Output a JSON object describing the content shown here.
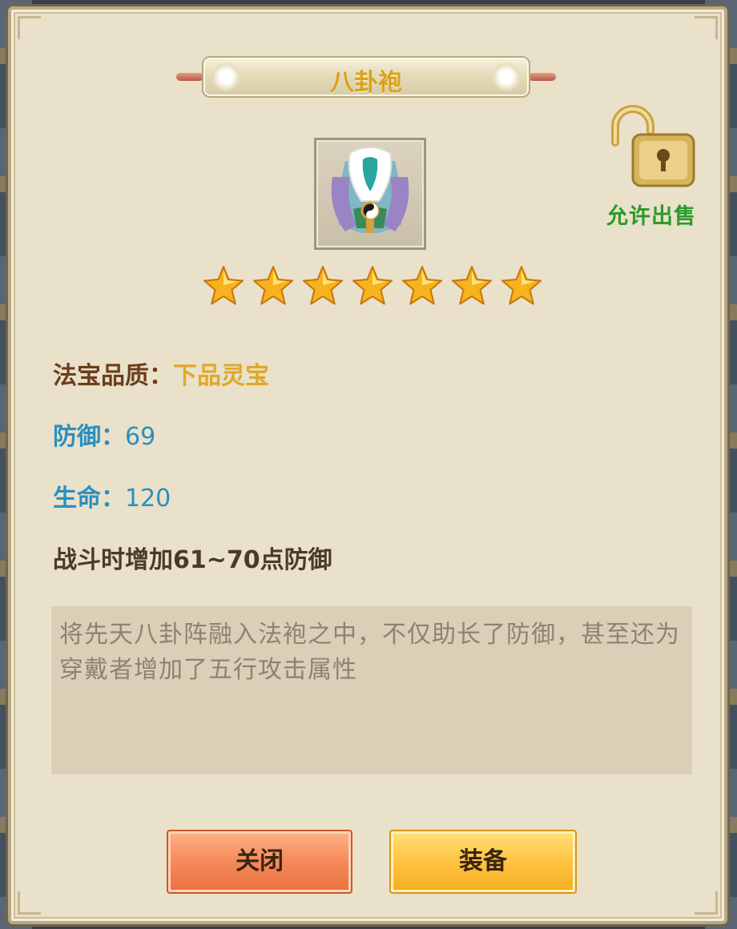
{
  "dialog": {
    "title": "八卦袍",
    "lock_label": "允许出售",
    "stars": 7,
    "quality_label": "法宝品质：",
    "quality_value": "下品灵宝",
    "defense_label": "防御：",
    "defense_value": "69",
    "hp_label": "生命：",
    "hp_value": "120",
    "effect": "战斗时增加61~70点防御",
    "description": "将先天八卦阵融入法袍之中，不仅助长了防御，甚至还为穿戴者增加了五行攻击属性",
    "close_label": "关闭",
    "equip_label": "装备"
  },
  "icons": {
    "lock": "unlocked-padlock-icon",
    "item": "bagua-robe-icon",
    "star": "star-icon"
  },
  "colors": {
    "title": "#d9a21c",
    "quality_value": "#e0a82a",
    "stat": "#2a8fc0",
    "lock_label": "#2a9a2a"
  }
}
